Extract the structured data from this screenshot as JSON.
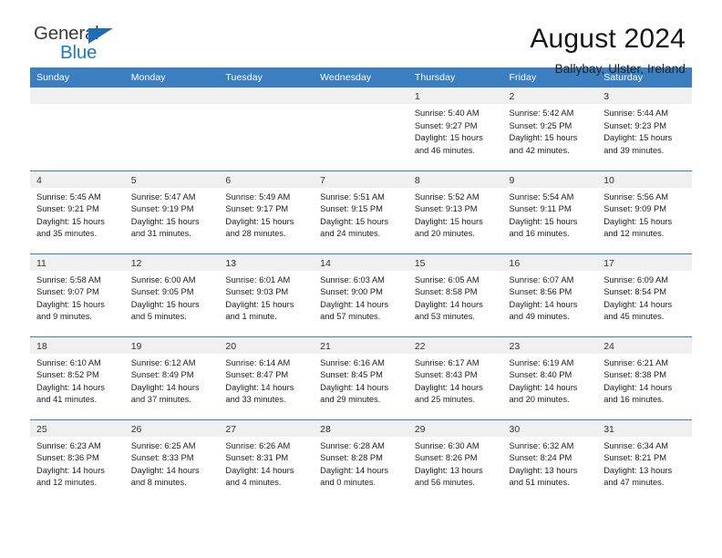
{
  "brand": {
    "name_part1": "General",
    "name_part2": "Blue",
    "triangle_color": "#1b6fba",
    "blue_color": "#1b7bc4"
  },
  "header": {
    "title": "August 2024",
    "subtitle": "Ballybay, Ulster, Ireland"
  },
  "calendar": {
    "header_bg": "#3c7fc1",
    "daynum_bg": "#f0f0f0",
    "weekdays": [
      "Sunday",
      "Monday",
      "Tuesday",
      "Wednesday",
      "Thursday",
      "Friday",
      "Saturday"
    ],
    "weeks": [
      [
        {
          "day": "",
          "sunrise": "",
          "sunset": "",
          "daylight": ""
        },
        {
          "day": "",
          "sunrise": "",
          "sunset": "",
          "daylight": ""
        },
        {
          "day": "",
          "sunrise": "",
          "sunset": "",
          "daylight": ""
        },
        {
          "day": "",
          "sunrise": "",
          "sunset": "",
          "daylight": ""
        },
        {
          "day": "1",
          "sunrise": "Sunrise: 5:40 AM",
          "sunset": "Sunset: 9:27 PM",
          "daylight": "Daylight: 15 hours and 46 minutes."
        },
        {
          "day": "2",
          "sunrise": "Sunrise: 5:42 AM",
          "sunset": "Sunset: 9:25 PM",
          "daylight": "Daylight: 15 hours and 42 minutes."
        },
        {
          "day": "3",
          "sunrise": "Sunrise: 5:44 AM",
          "sunset": "Sunset: 9:23 PM",
          "daylight": "Daylight: 15 hours and 39 minutes."
        }
      ],
      [
        {
          "day": "4",
          "sunrise": "Sunrise: 5:45 AM",
          "sunset": "Sunset: 9:21 PM",
          "daylight": "Daylight: 15 hours and 35 minutes."
        },
        {
          "day": "5",
          "sunrise": "Sunrise: 5:47 AM",
          "sunset": "Sunset: 9:19 PM",
          "daylight": "Daylight: 15 hours and 31 minutes."
        },
        {
          "day": "6",
          "sunrise": "Sunrise: 5:49 AM",
          "sunset": "Sunset: 9:17 PM",
          "daylight": "Daylight: 15 hours and 28 minutes."
        },
        {
          "day": "7",
          "sunrise": "Sunrise: 5:51 AM",
          "sunset": "Sunset: 9:15 PM",
          "daylight": "Daylight: 15 hours and 24 minutes."
        },
        {
          "day": "8",
          "sunrise": "Sunrise: 5:52 AM",
          "sunset": "Sunset: 9:13 PM",
          "daylight": "Daylight: 15 hours and 20 minutes."
        },
        {
          "day": "9",
          "sunrise": "Sunrise: 5:54 AM",
          "sunset": "Sunset: 9:11 PM",
          "daylight": "Daylight: 15 hours and 16 minutes."
        },
        {
          "day": "10",
          "sunrise": "Sunrise: 5:56 AM",
          "sunset": "Sunset: 9:09 PM",
          "daylight": "Daylight: 15 hours and 12 minutes."
        }
      ],
      [
        {
          "day": "11",
          "sunrise": "Sunrise: 5:58 AM",
          "sunset": "Sunset: 9:07 PM",
          "daylight": "Daylight: 15 hours and 9 minutes."
        },
        {
          "day": "12",
          "sunrise": "Sunrise: 6:00 AM",
          "sunset": "Sunset: 9:05 PM",
          "daylight": "Daylight: 15 hours and 5 minutes."
        },
        {
          "day": "13",
          "sunrise": "Sunrise: 6:01 AM",
          "sunset": "Sunset: 9:03 PM",
          "daylight": "Daylight: 15 hours and 1 minute."
        },
        {
          "day": "14",
          "sunrise": "Sunrise: 6:03 AM",
          "sunset": "Sunset: 9:00 PM",
          "daylight": "Daylight: 14 hours and 57 minutes."
        },
        {
          "day": "15",
          "sunrise": "Sunrise: 6:05 AM",
          "sunset": "Sunset: 8:58 PM",
          "daylight": "Daylight: 14 hours and 53 minutes."
        },
        {
          "day": "16",
          "sunrise": "Sunrise: 6:07 AM",
          "sunset": "Sunset: 8:56 PM",
          "daylight": "Daylight: 14 hours and 49 minutes."
        },
        {
          "day": "17",
          "sunrise": "Sunrise: 6:09 AM",
          "sunset": "Sunset: 8:54 PM",
          "daylight": "Daylight: 14 hours and 45 minutes."
        }
      ],
      [
        {
          "day": "18",
          "sunrise": "Sunrise: 6:10 AM",
          "sunset": "Sunset: 8:52 PM",
          "daylight": "Daylight: 14 hours and 41 minutes."
        },
        {
          "day": "19",
          "sunrise": "Sunrise: 6:12 AM",
          "sunset": "Sunset: 8:49 PM",
          "daylight": "Daylight: 14 hours and 37 minutes."
        },
        {
          "day": "20",
          "sunrise": "Sunrise: 6:14 AM",
          "sunset": "Sunset: 8:47 PM",
          "daylight": "Daylight: 14 hours and 33 minutes."
        },
        {
          "day": "21",
          "sunrise": "Sunrise: 6:16 AM",
          "sunset": "Sunset: 8:45 PM",
          "daylight": "Daylight: 14 hours and 29 minutes."
        },
        {
          "day": "22",
          "sunrise": "Sunrise: 6:17 AM",
          "sunset": "Sunset: 8:43 PM",
          "daylight": "Daylight: 14 hours and 25 minutes."
        },
        {
          "day": "23",
          "sunrise": "Sunrise: 6:19 AM",
          "sunset": "Sunset: 8:40 PM",
          "daylight": "Daylight: 14 hours and 20 minutes."
        },
        {
          "day": "24",
          "sunrise": "Sunrise: 6:21 AM",
          "sunset": "Sunset: 8:38 PM",
          "daylight": "Daylight: 14 hours and 16 minutes."
        }
      ],
      [
        {
          "day": "25",
          "sunrise": "Sunrise: 6:23 AM",
          "sunset": "Sunset: 8:36 PM",
          "daylight": "Daylight: 14 hours and 12 minutes."
        },
        {
          "day": "26",
          "sunrise": "Sunrise: 6:25 AM",
          "sunset": "Sunset: 8:33 PM",
          "daylight": "Daylight: 14 hours and 8 minutes."
        },
        {
          "day": "27",
          "sunrise": "Sunrise: 6:26 AM",
          "sunset": "Sunset: 8:31 PM",
          "daylight": "Daylight: 14 hours and 4 minutes."
        },
        {
          "day": "28",
          "sunrise": "Sunrise: 6:28 AM",
          "sunset": "Sunset: 8:28 PM",
          "daylight": "Daylight: 14 hours and 0 minutes."
        },
        {
          "day": "29",
          "sunrise": "Sunrise: 6:30 AM",
          "sunset": "Sunset: 8:26 PM",
          "daylight": "Daylight: 13 hours and 56 minutes."
        },
        {
          "day": "30",
          "sunrise": "Sunrise: 6:32 AM",
          "sunset": "Sunset: 8:24 PM",
          "daylight": "Daylight: 13 hours and 51 minutes."
        },
        {
          "day": "31",
          "sunrise": "Sunrise: 6:34 AM",
          "sunset": "Sunset: 8:21 PM",
          "daylight": "Daylight: 13 hours and 47 minutes."
        }
      ]
    ]
  }
}
